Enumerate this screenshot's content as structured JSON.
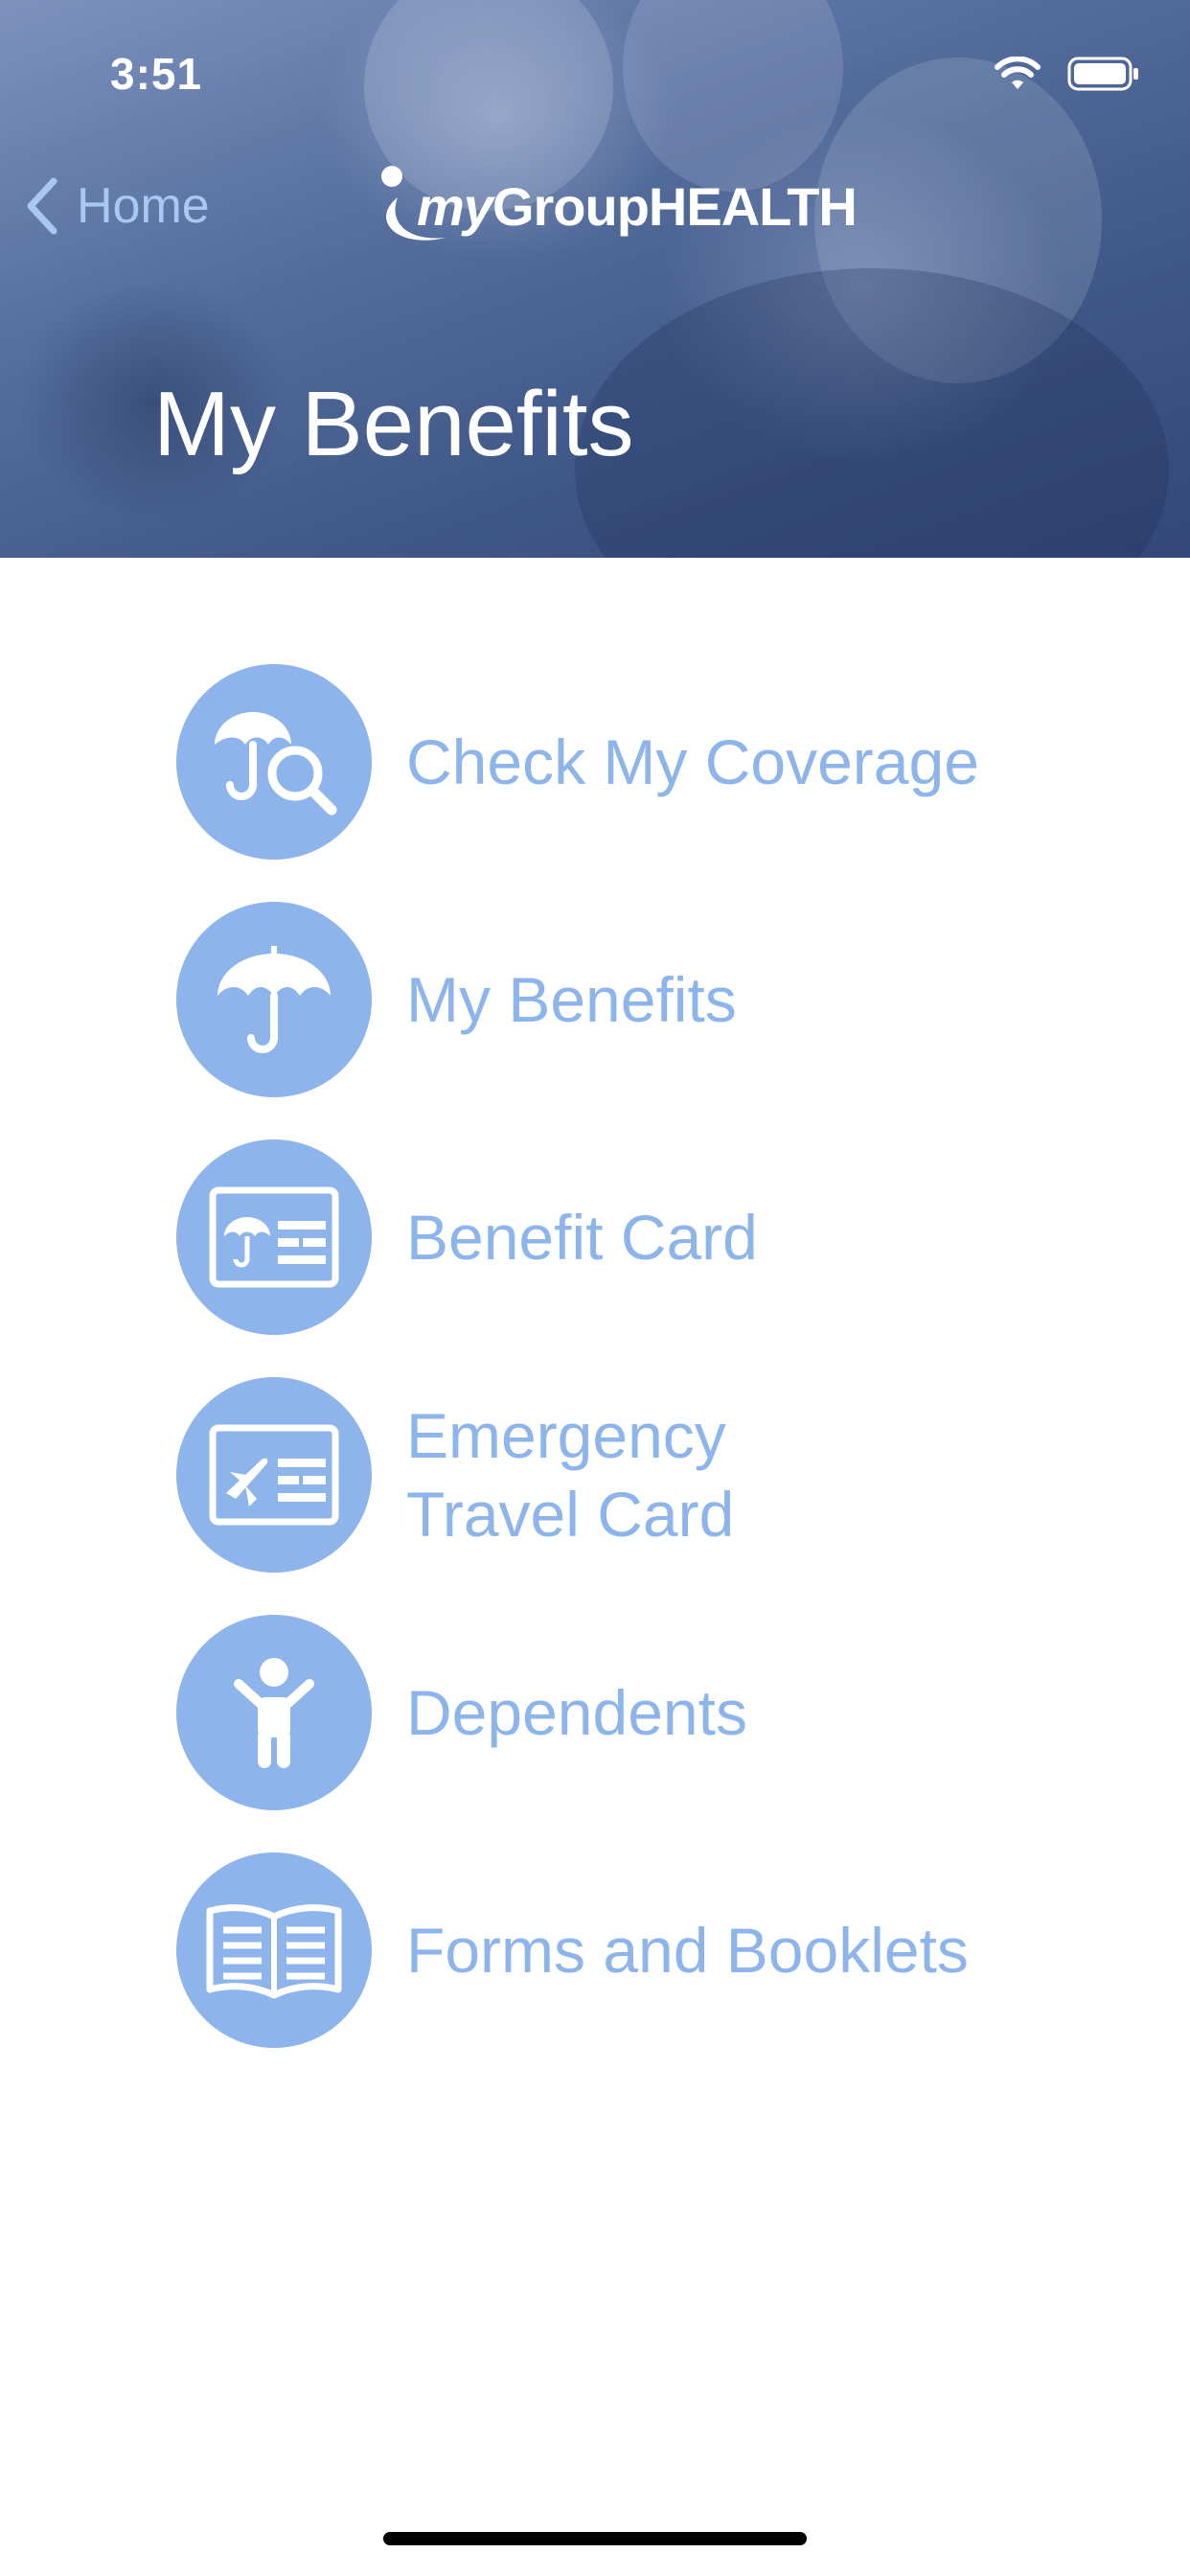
{
  "status_bar": {
    "time": "3:51"
  },
  "nav": {
    "back_label": "Home",
    "logo": {
      "script": "my",
      "brand": "GroupHEALTH"
    }
  },
  "header": {
    "title": "My Benefits"
  },
  "menu": {
    "items": [
      {
        "label": "Check My Coverage",
        "icon": "umbrella-search-icon"
      },
      {
        "label": "My Benefits",
        "icon": "umbrella-icon"
      },
      {
        "label": "Benefit Card",
        "icon": "benefit-card-icon"
      },
      {
        "label": "Emergency\nTravel Card",
        "icon": "travel-card-icon"
      },
      {
        "label": "Dependents",
        "icon": "child-icon"
      },
      {
        "label": "Forms and Booklets",
        "icon": "book-icon"
      }
    ]
  },
  "colors": {
    "accent": "#8db5eb",
    "header_overlay": "#4a6293",
    "back_link": "#a8c8f2"
  }
}
